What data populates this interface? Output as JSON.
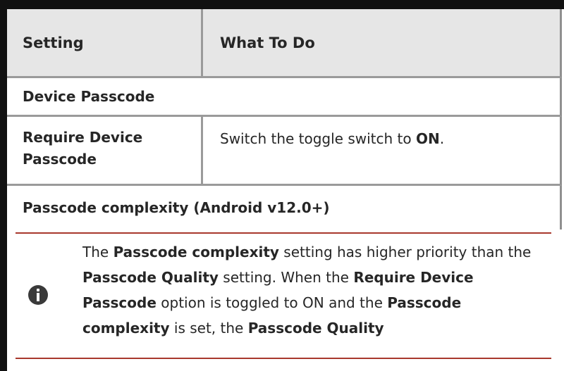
{
  "table": {
    "headers": {
      "setting": "Setting",
      "what_to_do": "What To Do"
    },
    "sections": [
      {
        "title": "Device Passcode",
        "rows": [
          {
            "setting": "Require Device Passcode",
            "what_to_do_prefix": "Switch the toggle switch to ",
            "what_to_do_bold": "ON",
            "what_to_do_suffix": "."
          }
        ]
      },
      {
        "title": "Passcode complexity (Android v12.0+)"
      }
    ]
  },
  "note": {
    "icon": "info-icon",
    "segments": [
      {
        "text": "The ",
        "bold": false
      },
      {
        "text": "Passcode complexity",
        "bold": true
      },
      {
        "text": " setting has higher priority than the ",
        "bold": false
      },
      {
        "text": "Passcode Quality",
        "bold": true
      },
      {
        "text": " setting. When the ",
        "bold": false
      },
      {
        "text": "Require Device Passcode",
        "bold": true
      },
      {
        "text": " option is toggled to ON and the ",
        "bold": false
      },
      {
        "text": "Passcode complexity",
        "bold": true
      },
      {
        "text": " is set, the ",
        "bold": false
      },
      {
        "text": "Passcode Quality",
        "bold": true
      }
    ]
  },
  "colors": {
    "header_bg": "#e6e6e6",
    "note_rule": "#a8382d",
    "border_dark": "#111111"
  }
}
